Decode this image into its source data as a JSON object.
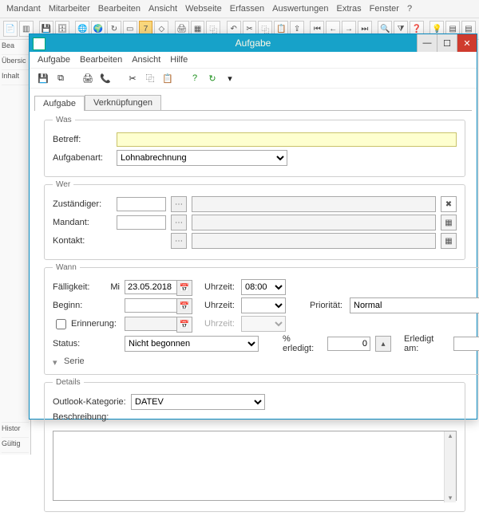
{
  "main_menu": [
    "Mandant",
    "Mitarbeiter",
    "Bearbeiten",
    "Ansicht",
    "Webseite",
    "Erfassen",
    "Auswertungen",
    "Extras",
    "Fenster",
    "?"
  ],
  "left_panel": {
    "items": [
      "Bea",
      "",
      "Übersic",
      "Inhalt",
      "",
      "",
      "",
      "",
      "",
      "Histor",
      "Gültig"
    ]
  },
  "dialog": {
    "title": "Aufgabe",
    "menu": [
      "Aufgabe",
      "Bearbeiten",
      "Ansicht",
      "Hilfe"
    ],
    "tabs": {
      "active": "Aufgabe",
      "other": "Verknüpfungen"
    },
    "was": {
      "legend": "Was",
      "betreff_label": "Betreff:",
      "betreff_value": "",
      "aufgabenart_label": "Aufgabenart:",
      "aufgabenart_value": "Lohnabrechnung"
    },
    "wer": {
      "legend": "Wer",
      "zustaendiger_label": "Zuständiger:",
      "zustaendiger_value": "",
      "mandant_label": "Mandant:",
      "mandant_value": "",
      "kontakt_label": "Kontakt:",
      "kontakt_value": ""
    },
    "wann": {
      "legend": "Wann",
      "faelligkeit_label": "Fälligkeit:",
      "faelligkeit_day": "Mi",
      "faelligkeit_value": "23.05.2018",
      "uhrzeit_label": "Uhrzeit:",
      "uhrzeit1": "08:00",
      "beginn_label": "Beginn:",
      "beginn_value": "",
      "uhrzeit2": "",
      "erinnerung_label": "Erinnerung:",
      "erinnerung_value": "",
      "uhrzeit3": "",
      "prioritaet_label": "Priorität:",
      "prioritaet_value": "Normal",
      "status_label": "Status:",
      "status_value": "Nicht begonnen",
      "erledigt_pct_label": "% erledigt:",
      "erledigt_pct_value": "0",
      "erledigt_am_label": "Erledigt am:",
      "erledigt_am_value": "",
      "serie_label": "Serie"
    },
    "details": {
      "legend": "Details",
      "outlook_label": "Outlook-Kategorie:",
      "outlook_value": "DATEV",
      "beschreibung_label": "Beschreibung:",
      "beschreibung_value": ""
    }
  }
}
